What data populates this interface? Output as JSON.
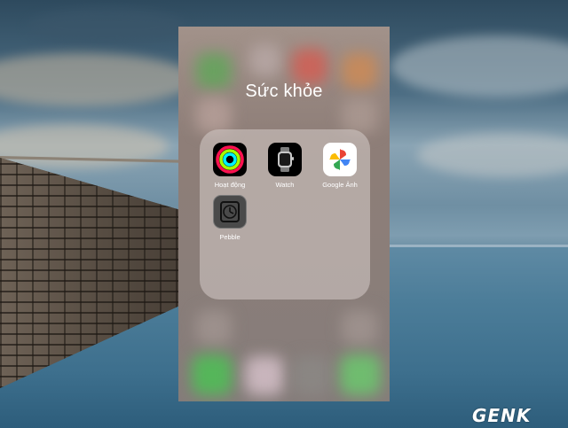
{
  "folder": {
    "title": "Sức khỏe",
    "apps": [
      {
        "label": "Hoạt động",
        "icon": "activity-rings-icon"
      },
      {
        "label": "Watch",
        "icon": "apple-watch-icon"
      },
      {
        "label": "Google Ảnh",
        "icon": "google-photos-pinwheel-icon"
      },
      {
        "label": "Pebble",
        "icon": "pebble-watch-icon"
      }
    ]
  },
  "watermark": {
    "text": "GENK"
  },
  "colors": {
    "activity_move": "#fa114f",
    "activity_exercise": "#a6ff00",
    "activity_stand": "#00f0ff",
    "photos_red": "#ea4335",
    "photos_yellow": "#fbbc05",
    "photos_green": "#34a853",
    "photos_blue": "#4285f4"
  }
}
